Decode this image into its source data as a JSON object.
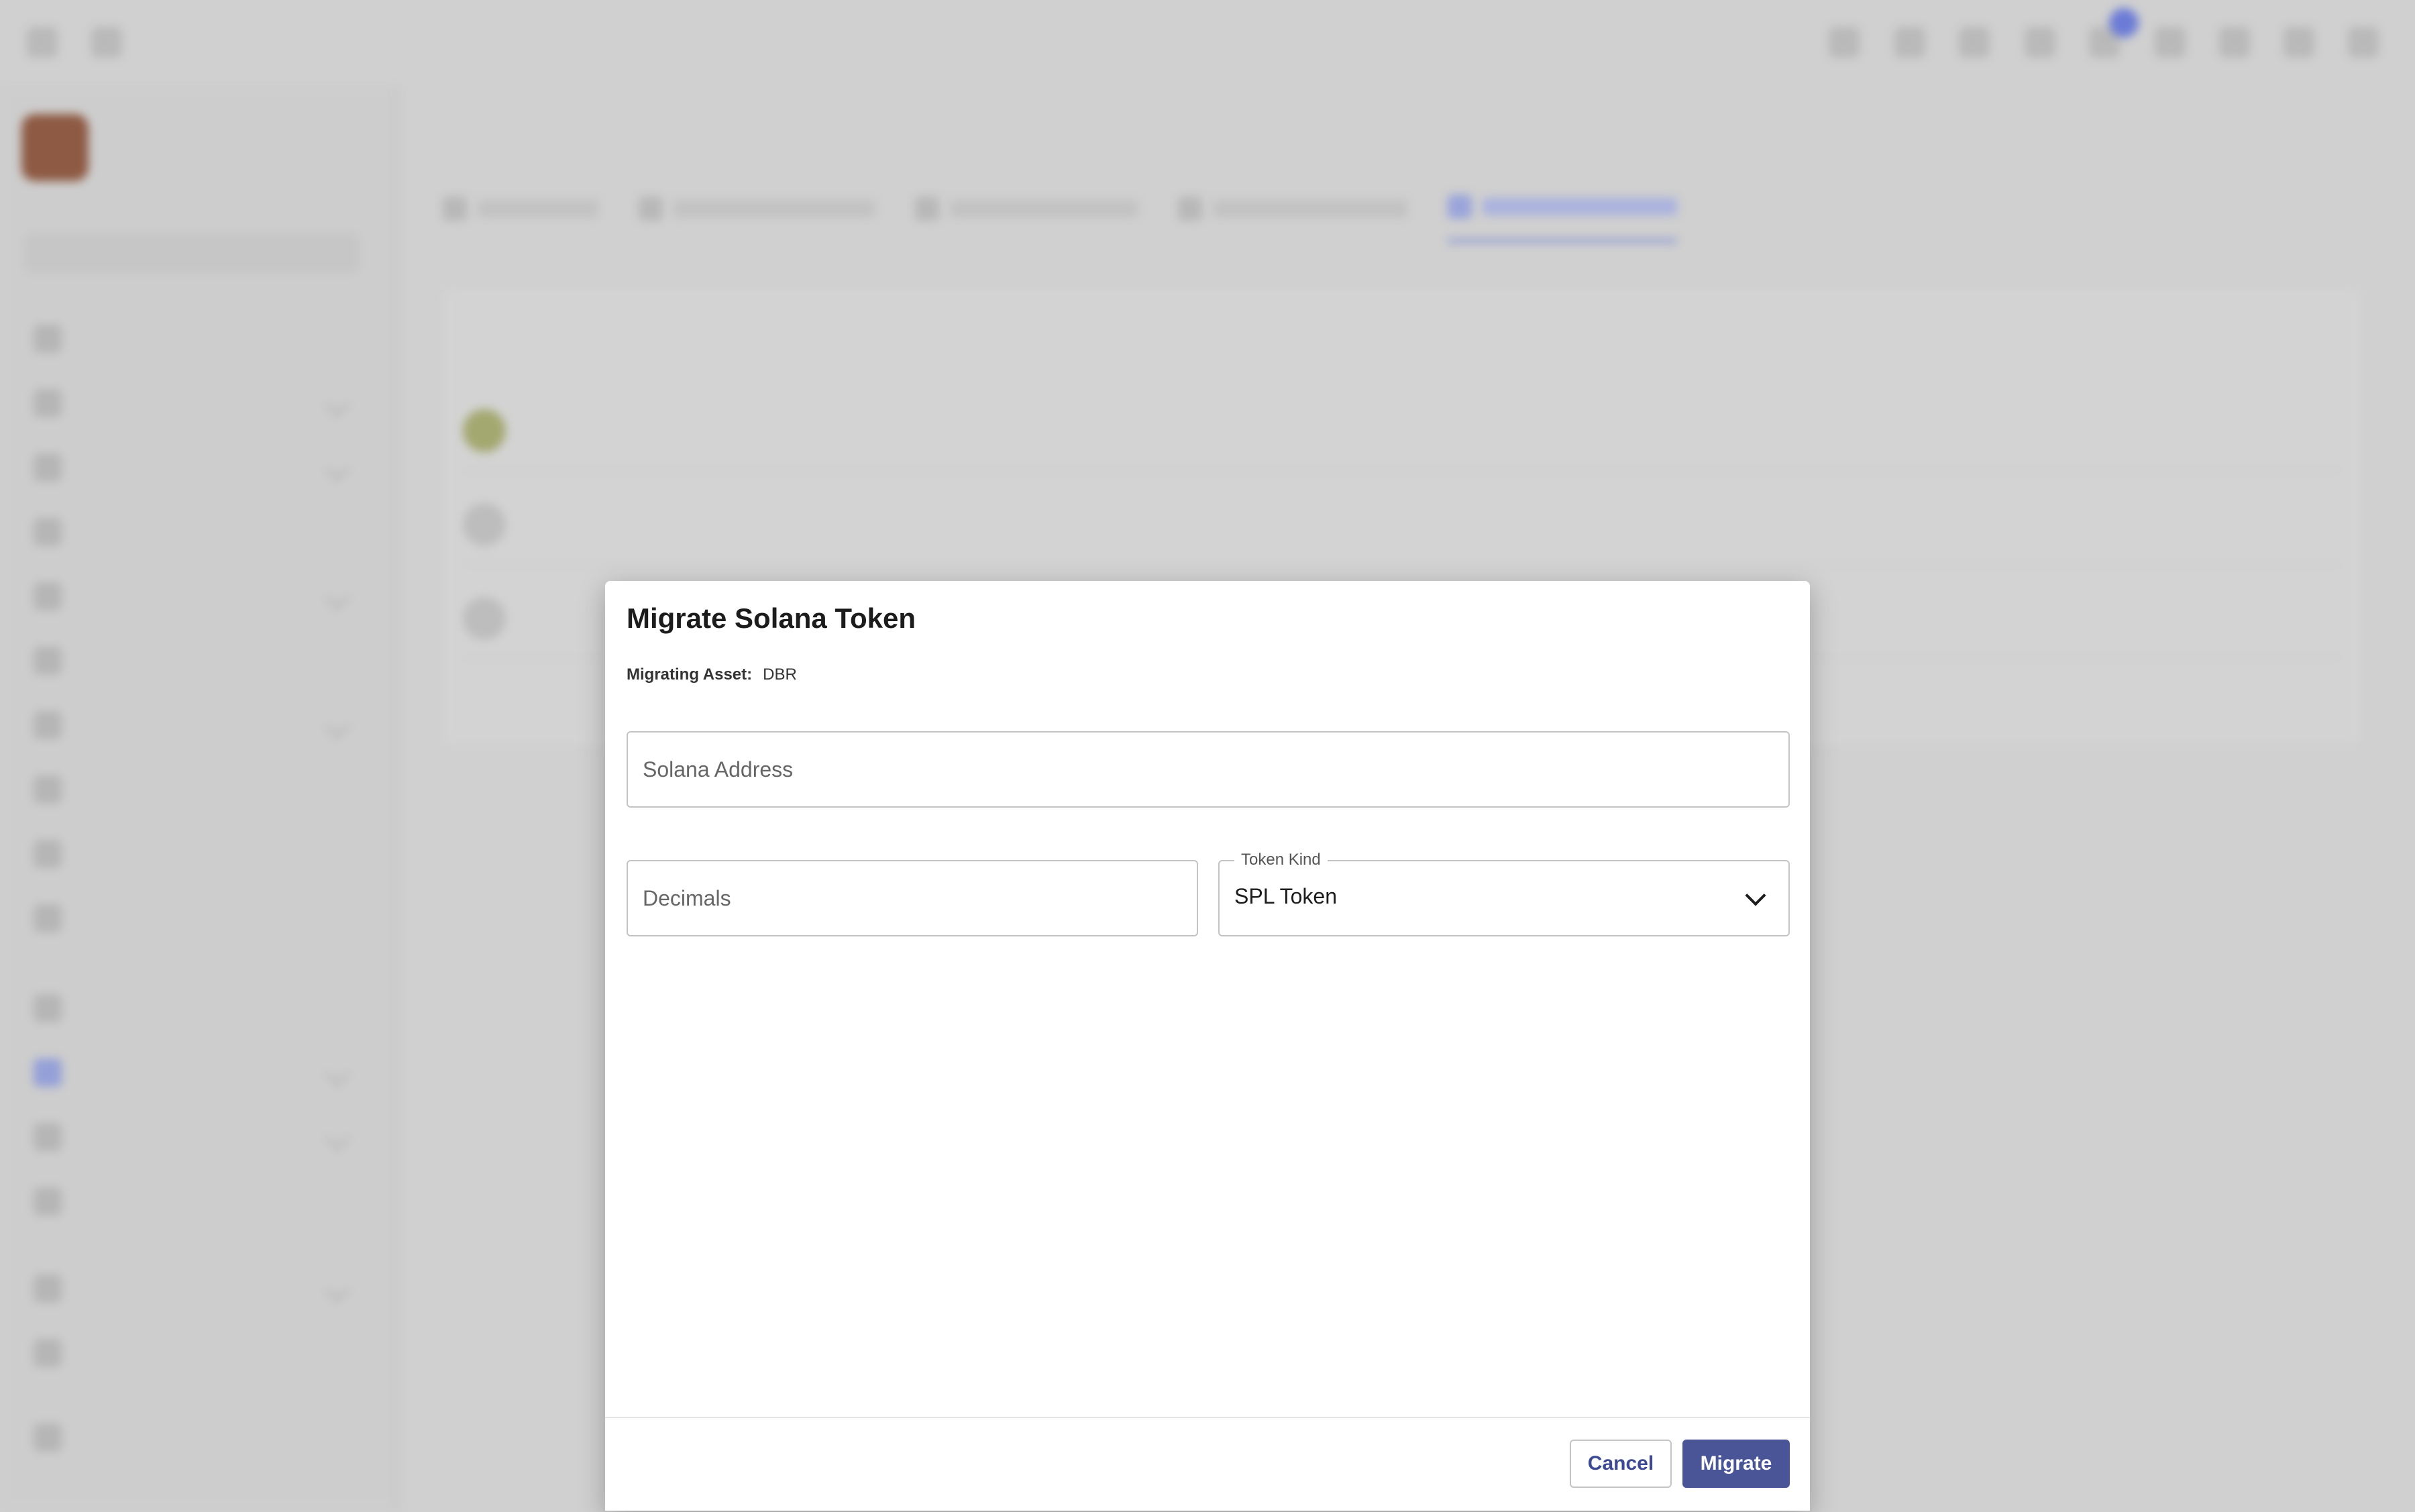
{
  "modal": {
    "title": "Migrate Solana Token",
    "asset_label": "Migrating Asset:",
    "asset_value": "DBR",
    "solana_address_placeholder": "Solana Address",
    "decimals_placeholder": "Decimals",
    "token_kind_label": "Token Kind",
    "token_kind_value": "SPL Token",
    "cancel_label": "Cancel",
    "migrate_label": "Migrate"
  },
  "colors": {
    "accent": "#4a5598",
    "overlay": "#d0d0d0",
    "modal_bg": "#ffffff"
  },
  "icons": {
    "token_kind_dropdown": "chevron-down-icon"
  }
}
